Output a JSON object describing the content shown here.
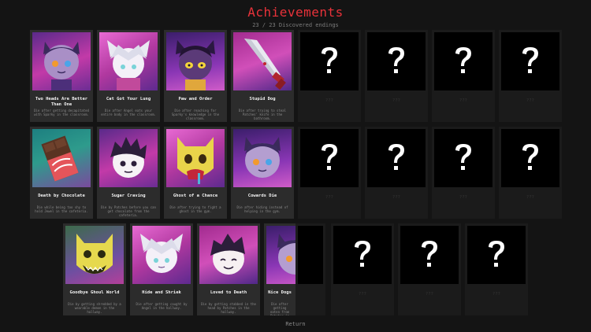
{
  "header": {
    "title": "Achievements",
    "subtitle": "23 / 23 Discovered endings"
  },
  "colors": {
    "title": "#e8323a",
    "card_bg": "#2c2c2c",
    "locked_bg": "#1b1b1b"
  },
  "achievements": [
    {
      "name": "Two Heads Are Better Than One",
      "desc": "Die after getting decapitated with Sparky in the classroom.",
      "unlocked": true,
      "icon": "two-heads-cat-portrait"
    },
    {
      "name": "Cat Got Your Lung",
      "desc": "Die after Angel eats your entire body in the classroom.",
      "unlocked": true,
      "icon": "white-haired-cat-portrait"
    },
    {
      "name": "Paw and Order",
      "desc": "Die after reaching for Sparky's knowledge in the classroom.",
      "unlocked": true,
      "icon": "dark-cat-yellow-eyes-portrait"
    },
    {
      "name": "Stupid Dog",
      "desc": "Die after trying to steal Patches' knife in the bathroom.",
      "unlocked": true,
      "icon": "bloody-knife"
    },
    {
      "name": "???",
      "desc": "",
      "unlocked": false,
      "icon": "question-mark"
    },
    {
      "name": "???",
      "desc": "",
      "unlocked": false,
      "icon": "question-mark"
    },
    {
      "name": "???",
      "desc": "",
      "unlocked": false,
      "icon": "question-mark"
    },
    {
      "name": "???",
      "desc": "",
      "unlocked": false,
      "icon": "question-mark"
    },
    {
      "name": "Death by Chocolate",
      "desc": "Die while being too shy to hold Jewel in the cafeteria.",
      "unlocked": true,
      "icon": "chocolate-bar"
    },
    {
      "name": "Sugar Craving",
      "desc": "Die by Patches before you can get chocolate from the cafeteria.",
      "unlocked": true,
      "icon": "spiky-hair-boy-portrait"
    },
    {
      "name": "Ghost of a Chance",
      "desc": "Die after trying to fight a ghost in the gym.",
      "unlocked": true,
      "icon": "yellow-ghost-mask"
    },
    {
      "name": "Cowards Die",
      "desc": "Die after hiding instead of helping in the gym.",
      "unlocked": true,
      "icon": "purple-cat-blue-eyes-portrait"
    },
    {
      "name": "???",
      "desc": "",
      "unlocked": false,
      "icon": "question-mark"
    },
    {
      "name": "???",
      "desc": "",
      "unlocked": false,
      "icon": "question-mark"
    },
    {
      "name": "???",
      "desc": "",
      "unlocked": false,
      "icon": "question-mark"
    },
    {
      "name": "???",
      "desc": "",
      "unlocked": false,
      "icon": "question-mark"
    },
    {
      "name": "Goodbye Ghoul World",
      "desc": "Die by getting shredded by a wearable demon in the hallway.",
      "unlocked": true,
      "icon": "grinning-ghost-mask"
    },
    {
      "name": "Hide and Shriek",
      "desc": "Die after getting caught by Angel in the hallway.",
      "unlocked": true,
      "icon": "white-haired-cat-portrait-2"
    },
    {
      "name": "Loved to Death",
      "desc": "Die by getting stabbed in the head by Patches in the hallway.",
      "unlocked": true,
      "icon": "smiling-boy-portrait"
    },
    {
      "name": "Nice Dogs",
      "desc": "Die after getting eaten from Patches in the hallway.",
      "unlocked": true,
      "icon": "cat-partial-portrait"
    },
    {
      "name": "???",
      "desc": "",
      "unlocked": false,
      "icon": "question-mark"
    },
    {
      "name": "???",
      "desc": "",
      "unlocked": false,
      "icon": "question-mark"
    },
    {
      "name": "???",
      "desc": "",
      "unlocked": false,
      "icon": "question-mark"
    },
    {
      "name": "???",
      "desc": "",
      "unlocked": false,
      "icon": "question-mark"
    }
  ],
  "footer": {
    "return_label": "Return"
  }
}
